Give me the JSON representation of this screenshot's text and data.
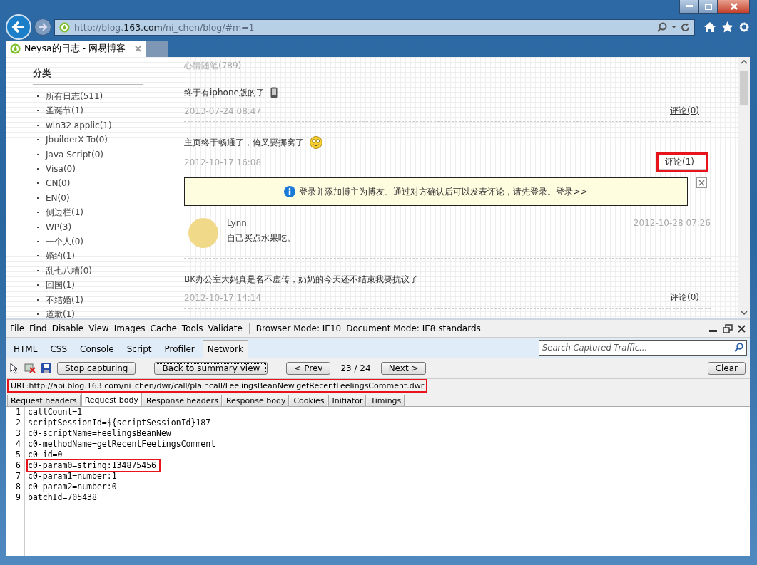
{
  "browser": {
    "address": "http://blog.**163.com**/ni_chen/blog/#m=1",
    "tabs": [
      {
        "title": "Neysa的日志 - 网易博客",
        "selected": true
      }
    ]
  },
  "sidebar": {
    "heading": "分类",
    "items": [
      "所有日志(511)",
      "圣诞节(1)",
      "win32 applic(1)",
      "JbuilderX To(0)",
      "Java Script(0)",
      "Visa(0)",
      "CN(0)",
      "EN(0)",
      "侧边栏(1)",
      "WP(3)",
      "一个人(0)",
      "婚约(1)",
      "乱七八糟(0)",
      "回国(1)",
      "不结婚(1)",
      "道歉(1)"
    ]
  },
  "feed": {
    "category": "心情随笔(789)",
    "posts": [
      {
        "title": "终于有iphone版的了",
        "kind": "phone",
        "date": "2013-07-24 08:47",
        "comment_link": "评论(0)",
        "highlighted": false
      },
      {
        "title": "主页终于畅通了，俺又要挪窝了",
        "kind": "emoji",
        "date": "2012-10-17 16:08",
        "comment_link": "评论(1)",
        "highlighted": true,
        "notice": "登录并添加博主为博友、通过对方确认后可以发表评论，请先登录。登录>>",
        "comments": [
          {
            "author": "Lynn",
            "text": "自己买点水果吃。",
            "date": "2012-10-28 07:26"
          }
        ]
      },
      {
        "kind": "plain",
        "title": "BK办公室大妈真是名不虚传，奶奶的今天还不结束我要抗议了",
        "date": "2012-10-17 14:14",
        "comment_link": "评论(0)",
        "highlighted": false
      }
    ]
  },
  "devtools": {
    "menu": [
      "File",
      "Find",
      "Disable",
      "View",
      "Images",
      "Cache",
      "Tools",
      "Validate"
    ],
    "modes": [
      "Browser Mode: IE10",
      "Document Mode: IE8 standards"
    ],
    "tabs": [
      {
        "label": "HTML",
        "selected": false
      },
      {
        "label": "CSS",
        "selected": false
      },
      {
        "label": "Console",
        "selected": false
      },
      {
        "label": "Script",
        "selected": false
      },
      {
        "label": "Profiler",
        "selected": false
      },
      {
        "label": "Network",
        "selected": true
      }
    ],
    "search": {
      "placeholder": "Search Captured Traffic..."
    },
    "toolbar": {
      "stop": "Stop capturing",
      "back": "Back to summary view",
      "prev": "< Prev",
      "counter": "23 / 24",
      "next": "Next >",
      "clear": "Clear"
    },
    "url": {
      "text": "URL:http://api.blog.163.com/ni_chen/dwr/call/plaincall/FeelingsBeanNew.getRecentFeelingsComment.dwr",
      "highlighted": true
    },
    "subtabs": [
      {
        "label": "Request headers",
        "selected": false
      },
      {
        "label": "Request body",
        "selected": true
      },
      {
        "label": "Response headers",
        "selected": false
      },
      {
        "label": "Response body",
        "selected": false
      },
      {
        "label": "Cookies",
        "selected": false
      },
      {
        "label": "Initiator",
        "selected": false
      },
      {
        "label": "Timings",
        "selected": false
      }
    ],
    "lines": [
      {
        "number": "1",
        "text": "callCount=1",
        "highlighted": false
      },
      {
        "number": "2",
        "text": "scriptSessionId=${scriptSessionId}187",
        "highlighted": false
      },
      {
        "number": "3",
        "text": "c0-scriptName=FeelingsBeanNew",
        "highlighted": false
      },
      {
        "number": "4",
        "text": "c0-methodName=getRecentFeelingsComment",
        "highlighted": false
      },
      {
        "number": "5",
        "text": "c0-id=0",
        "highlighted": false
      },
      {
        "number": "6",
        "text": "c0-param0=string:134875456",
        "highlighted": true
      },
      {
        "number": "7",
        "text": "c0-param1=number:1",
        "highlighted": false
      },
      {
        "number": "8",
        "text": "c0-param2=number:0",
        "highlighted": false
      },
      {
        "number": "9",
        "text": "batchId=705438",
        "highlighted": false
      }
    ]
  }
}
